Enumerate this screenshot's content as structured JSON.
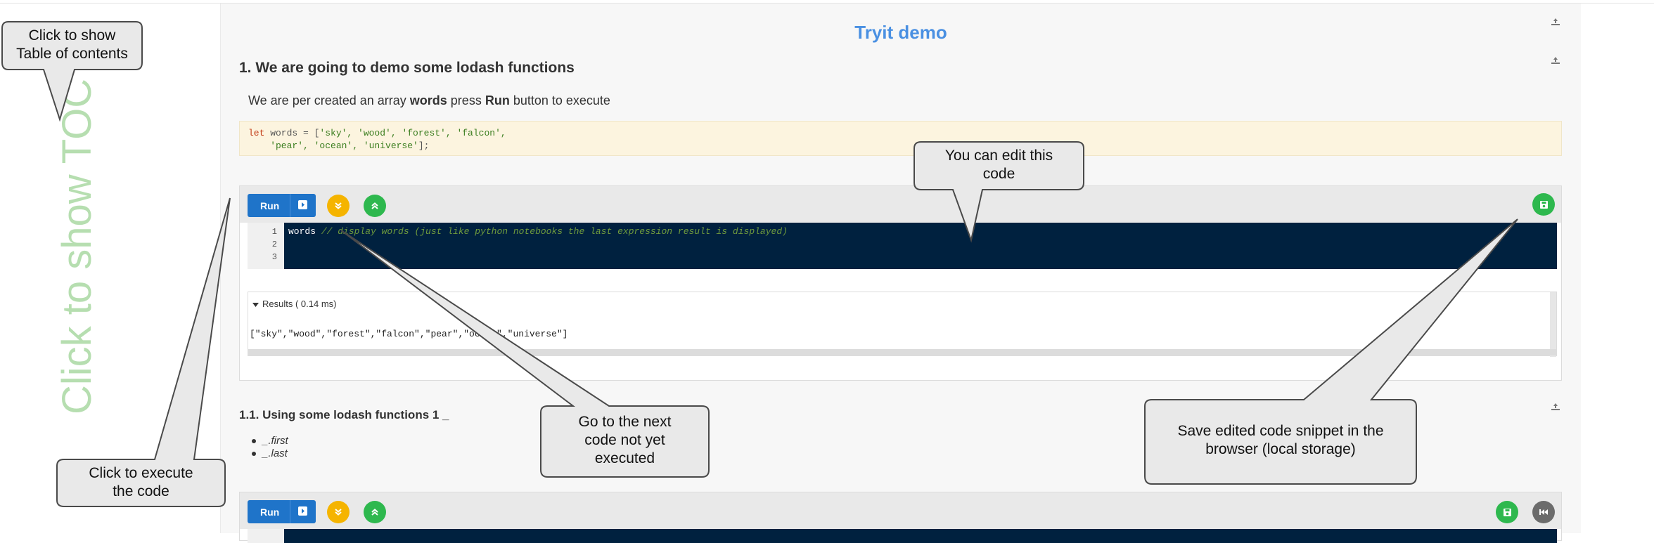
{
  "page": {
    "title": "Tryit demo"
  },
  "section1": {
    "heading": "1.  We are going to demo some lodash functions",
    "intro_part1": "We are per created an array ",
    "intro_words": "words",
    "intro_part2": " press ",
    "intro_run": "Run",
    "intro_part3": " button to execute",
    "code_kw": "let",
    "code_line1_var": " words = [",
    "code_line1_strs": "'sky', 'wood', 'forest', 'falcon',",
    "code_line2_strs": "    'pear', 'ocean', 'universe'",
    "code_line2_end": "];"
  },
  "cell1": {
    "run_label": "Run",
    "line_numbers": [
      "1",
      "2",
      "3"
    ],
    "code_text": "words",
    "code_comment": " // display words (just like python notebooks the last expression result is displayed)",
    "results_header": "Results ( 0.14 ms)",
    "results_output": "[\"sky\",\"wood\",\"forest\",\"falcon\",\"pear\",\"ocean\",\"universe\"]"
  },
  "section11": {
    "heading": "1.1.  Using some lodash functions 1 _",
    "bullets": [
      "_.first",
      "_.last"
    ]
  },
  "cell2": {
    "run_label": "Run"
  },
  "sidebar": {
    "toc_text": "Click to show TOC"
  },
  "callouts": {
    "toc": "Click to show\nTable of contents",
    "edit": "You can edit this\ncode",
    "next": "Go to the next\ncode not yet\nexecuted",
    "save": "Save edited code snippet in the\nbrowser (local storage)",
    "execute": "Click to execute\nthe code"
  },
  "colors": {
    "title": "#4a90e2",
    "run_button": "#1f74c9",
    "next_button": "#f5b400",
    "up_button": "#2eb84e",
    "editor_bg": "#00213f",
    "toc_text": "#b6deb0"
  },
  "icons": [
    "link-icon",
    "play-icon",
    "chevron-double-down-icon",
    "chevron-double-up-icon",
    "save-icon",
    "reset-icon",
    "caret-down-icon"
  ]
}
